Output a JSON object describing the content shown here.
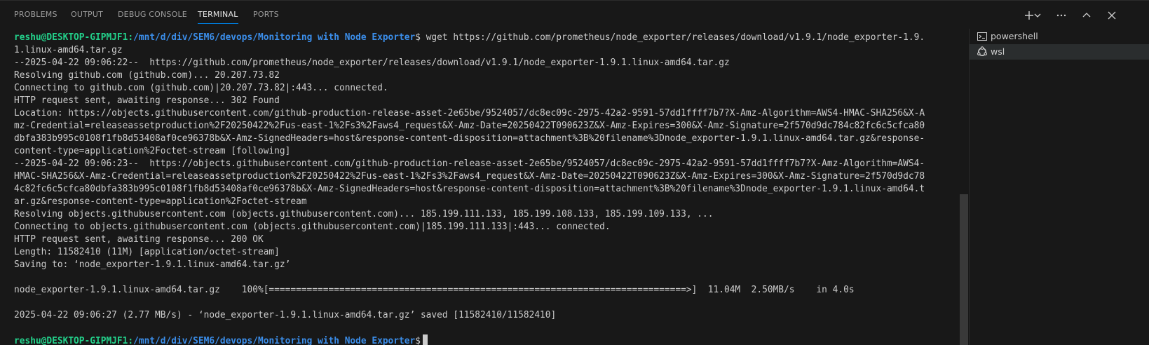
{
  "tabs": [
    {
      "label": "PROBLEMS",
      "active": false
    },
    {
      "label": "OUTPUT",
      "active": false
    },
    {
      "label": "DEBUG CONSOLE",
      "active": false
    },
    {
      "label": "TERMINAL",
      "active": true
    },
    {
      "label": "PORTS",
      "active": false
    }
  ],
  "actions": [
    {
      "icon": "plus-icon"
    },
    {
      "icon": "chevron-down-icon"
    },
    {
      "icon": "ellipsis-icon"
    },
    {
      "icon": "chevron-up-icon"
    },
    {
      "icon": "close-icon"
    }
  ],
  "prompt": {
    "user": "reshu@DESKTOP-GIPMJF1",
    "sep": ":",
    "path": "/mnt/d/div/SEM6/devops/Monitoring with Node Exporter",
    "symbol": "$"
  },
  "terminal": {
    "command": " wget https://github.com/prometheus/node_exporter/releases/download/v1.9.1/node_exporter-1.9.",
    "lines": [
      "1.linux-amd64.tar.gz",
      "--2025-04-22 09:06:22--  https://github.com/prometheus/node_exporter/releases/download/v1.9.1/node_exporter-1.9.1.linux-amd64.tar.gz",
      "Resolving github.com (github.com)... 20.207.73.82",
      "Connecting to github.com (github.com)|20.207.73.82|:443... connected.",
      "HTTP request sent, awaiting response... 302 Found",
      "Location: https://objects.githubusercontent.com/github-production-release-asset-2e65be/9524057/dc8ec09c-2975-42a2-9591-57dd1ffff7b7?X-Amz-Algorithm=AWS4-HMAC-SHA256&X-A",
      "mz-Credential=releaseassetproduction%2F20250422%2Fus-east-1%2Fs3%2Faws4_request&X-Amz-Date=20250422T090623Z&X-Amz-Expires=300&X-Amz-Signature=2f570d9dc784c82fc6c5cfca80",
      "dbfa383b995c0108f1fb8d53408af0ce96378b&X-Amz-SignedHeaders=host&response-content-disposition=attachment%3B%20filename%3Dnode_exporter-1.9.1.linux-amd64.tar.gz&response-",
      "content-type=application%2Foctet-stream [following]",
      "--2025-04-22 09:06:23--  https://objects.githubusercontent.com/github-production-release-asset-2e65be/9524057/dc8ec09c-2975-42a2-9591-57dd1ffff7b7?X-Amz-Algorithm=AWS4-",
      "HMAC-SHA256&X-Amz-Credential=releaseassetproduction%2F20250422%2Fus-east-1%2Fs3%2Faws4_request&X-Amz-Date=20250422T090623Z&X-Amz-Expires=300&X-Amz-Signature=2f570d9dc78",
      "4c82fc6c5cfca80dbfa383b995c0108f1fb8d53408af0ce96378b&X-Amz-SignedHeaders=host&response-content-disposition=attachment%3B%20filename%3Dnode_exporter-1.9.1.linux-amd64.t",
      "ar.gz&response-content-type=application%2Foctet-stream",
      "Resolving objects.githubusercontent.com (objects.githubusercontent.com)... 185.199.111.133, 185.199.108.133, 185.199.109.133, ...",
      "Connecting to objects.githubusercontent.com (objects.githubusercontent.com)|185.199.111.133|:443... connected.",
      "HTTP request sent, awaiting response... 200 OK",
      "Length: 11582410 (11M) [application/octet-stream]",
      "Saving to: ‘node_exporter-1.9.1.linux-amd64.tar.gz’",
      "",
      "node_exporter-1.9.1.linux-amd64.tar.gz    100%[=============================================================================>]  11.04M  2.50MB/s    in 4.0s",
      "",
      "2025-04-22 09:06:27 (2.77 MB/s) - ‘node_exporter-1.9.1.linux-amd64.tar.gz’ saved [11582410/11582410]",
      ""
    ]
  },
  "terminal_list": [
    {
      "label": "powershell",
      "icon": "terminal-icon",
      "selected": false
    },
    {
      "label": "wsl",
      "icon": "linux-icon",
      "selected": true
    }
  ],
  "colors": {
    "background": "#181818",
    "prompt_user": "#23d18b",
    "prompt_path": "#3b8eea",
    "text": "#cccccc",
    "active_tab_underline": "#0078d4"
  }
}
